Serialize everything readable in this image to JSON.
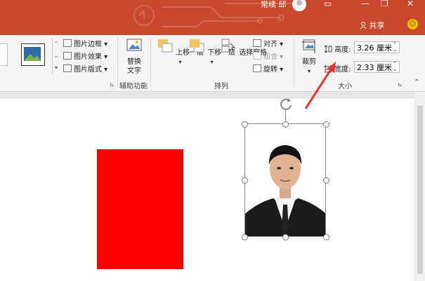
{
  "titlebar": {
    "user_name": "常续 邱",
    "share_label": "共享",
    "window_buttons": [
      "▭",
      "—",
      "❐",
      "✕"
    ]
  },
  "ribbon": {
    "picture_styles": {
      "border": "图片边框",
      "effects": "图片效果",
      "layout": "图片版式"
    },
    "accessibility": {
      "button": "替换\n文字",
      "group_label": "辅助功能"
    },
    "arrange": {
      "bring_forward": "上移一层",
      "send_backward": "下移一层",
      "selection_pane": "选择窗格",
      "align": "对齐",
      "group": "组合",
      "rotate": "旋转",
      "group_label": "排列"
    },
    "size": {
      "crop": "裁剪",
      "height_label": "高度:",
      "height_value": "3.26 厘米",
      "width_label": "宽度:",
      "width_value": "2.33 厘米",
      "group_label": "大小"
    }
  },
  "colors": {
    "titlebar": "#c9482d",
    "annotation_arrow": "#e8322d",
    "red_rect": "#ff0000"
  }
}
